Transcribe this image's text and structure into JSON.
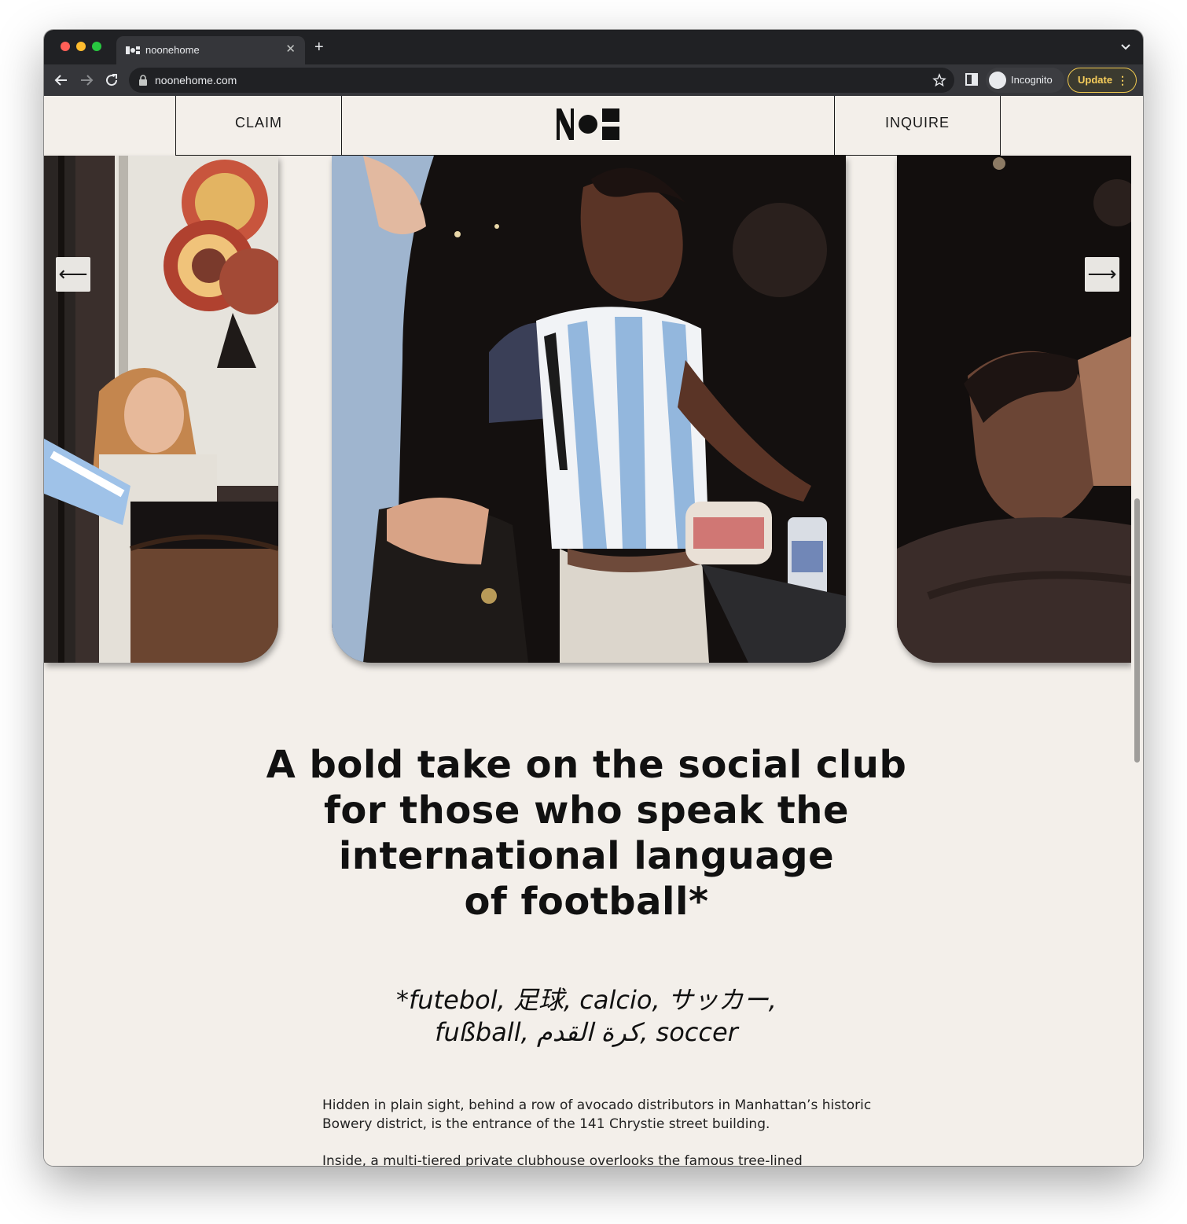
{
  "browser": {
    "tab_title": "noonehome",
    "new_tab_symbol": "+",
    "close_symbol": "✕",
    "url": "noonehome.com",
    "profile_label": "Incognito",
    "update_label": "Update",
    "update_menu_symbol": "⋮"
  },
  "header": {
    "claim_label": "CLAIM",
    "inquire_label": "INQUIRE"
  },
  "carousel": {
    "prev_symbol": "⟵",
    "next_symbol": "⟶"
  },
  "hero": {
    "headline_lines": [
      "A bold take on the social club",
      "for those who speak the",
      "international language",
      "of football*"
    ],
    "footnote_lines": [
      "*futebol, 足球, calcio, サッカー,",
      "fußball, كرة القدم, soccer"
    ]
  },
  "body": {
    "paragraphs": [
      "Hidden in plain sight, behind a row of avocado distributors in Manhattan’s historic Bowery district, is the entrance of the 141 Chrystie street building.",
      "Inside, a multi-tiered private clubhouse overlooks the famous tree-lined"
    ]
  },
  "colors": {
    "page_background": "#f3efea",
    "chrome_dark": "#202124",
    "update_accent": "#f6cd5b",
    "text": "#111111"
  }
}
